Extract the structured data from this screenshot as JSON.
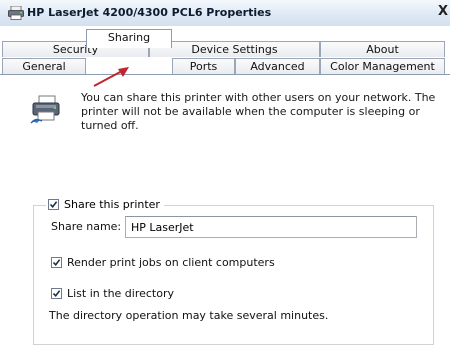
{
  "window": {
    "title": "HP LaserJet 4200/4300 PCL6 Properties",
    "close_glyph": "X"
  },
  "tabs": {
    "row_back": [
      {
        "label": "Security"
      },
      {
        "label": "Device Settings"
      },
      {
        "label": "About"
      }
    ],
    "row_front": [
      {
        "label": "General"
      },
      {
        "label": "Sharing"
      },
      {
        "label": "Ports"
      },
      {
        "label": "Advanced"
      },
      {
        "label": "Color Management"
      }
    ],
    "active": "Sharing"
  },
  "sharing": {
    "info_text": "You can share this printer with other users on your network. The printer will not be available when the computer is sleeping or turned off.",
    "share_printer": {
      "label": "Share this printer",
      "checked": true
    },
    "share_name": {
      "label": "Share name:",
      "value": "HP LaserJet"
    },
    "render_jobs": {
      "label": "Render print jobs on client computers",
      "checked": true
    },
    "list_directory": {
      "label": "List in the directory",
      "checked": true
    },
    "directory_note": "The directory operation may take several minutes."
  },
  "icons": {
    "window": "printer-icon",
    "info": "shared-printer-icon",
    "annotation": "red-arrow"
  },
  "colors": {
    "annotation_arrow": "#c0262d",
    "checkmark": "#1b2a44"
  }
}
